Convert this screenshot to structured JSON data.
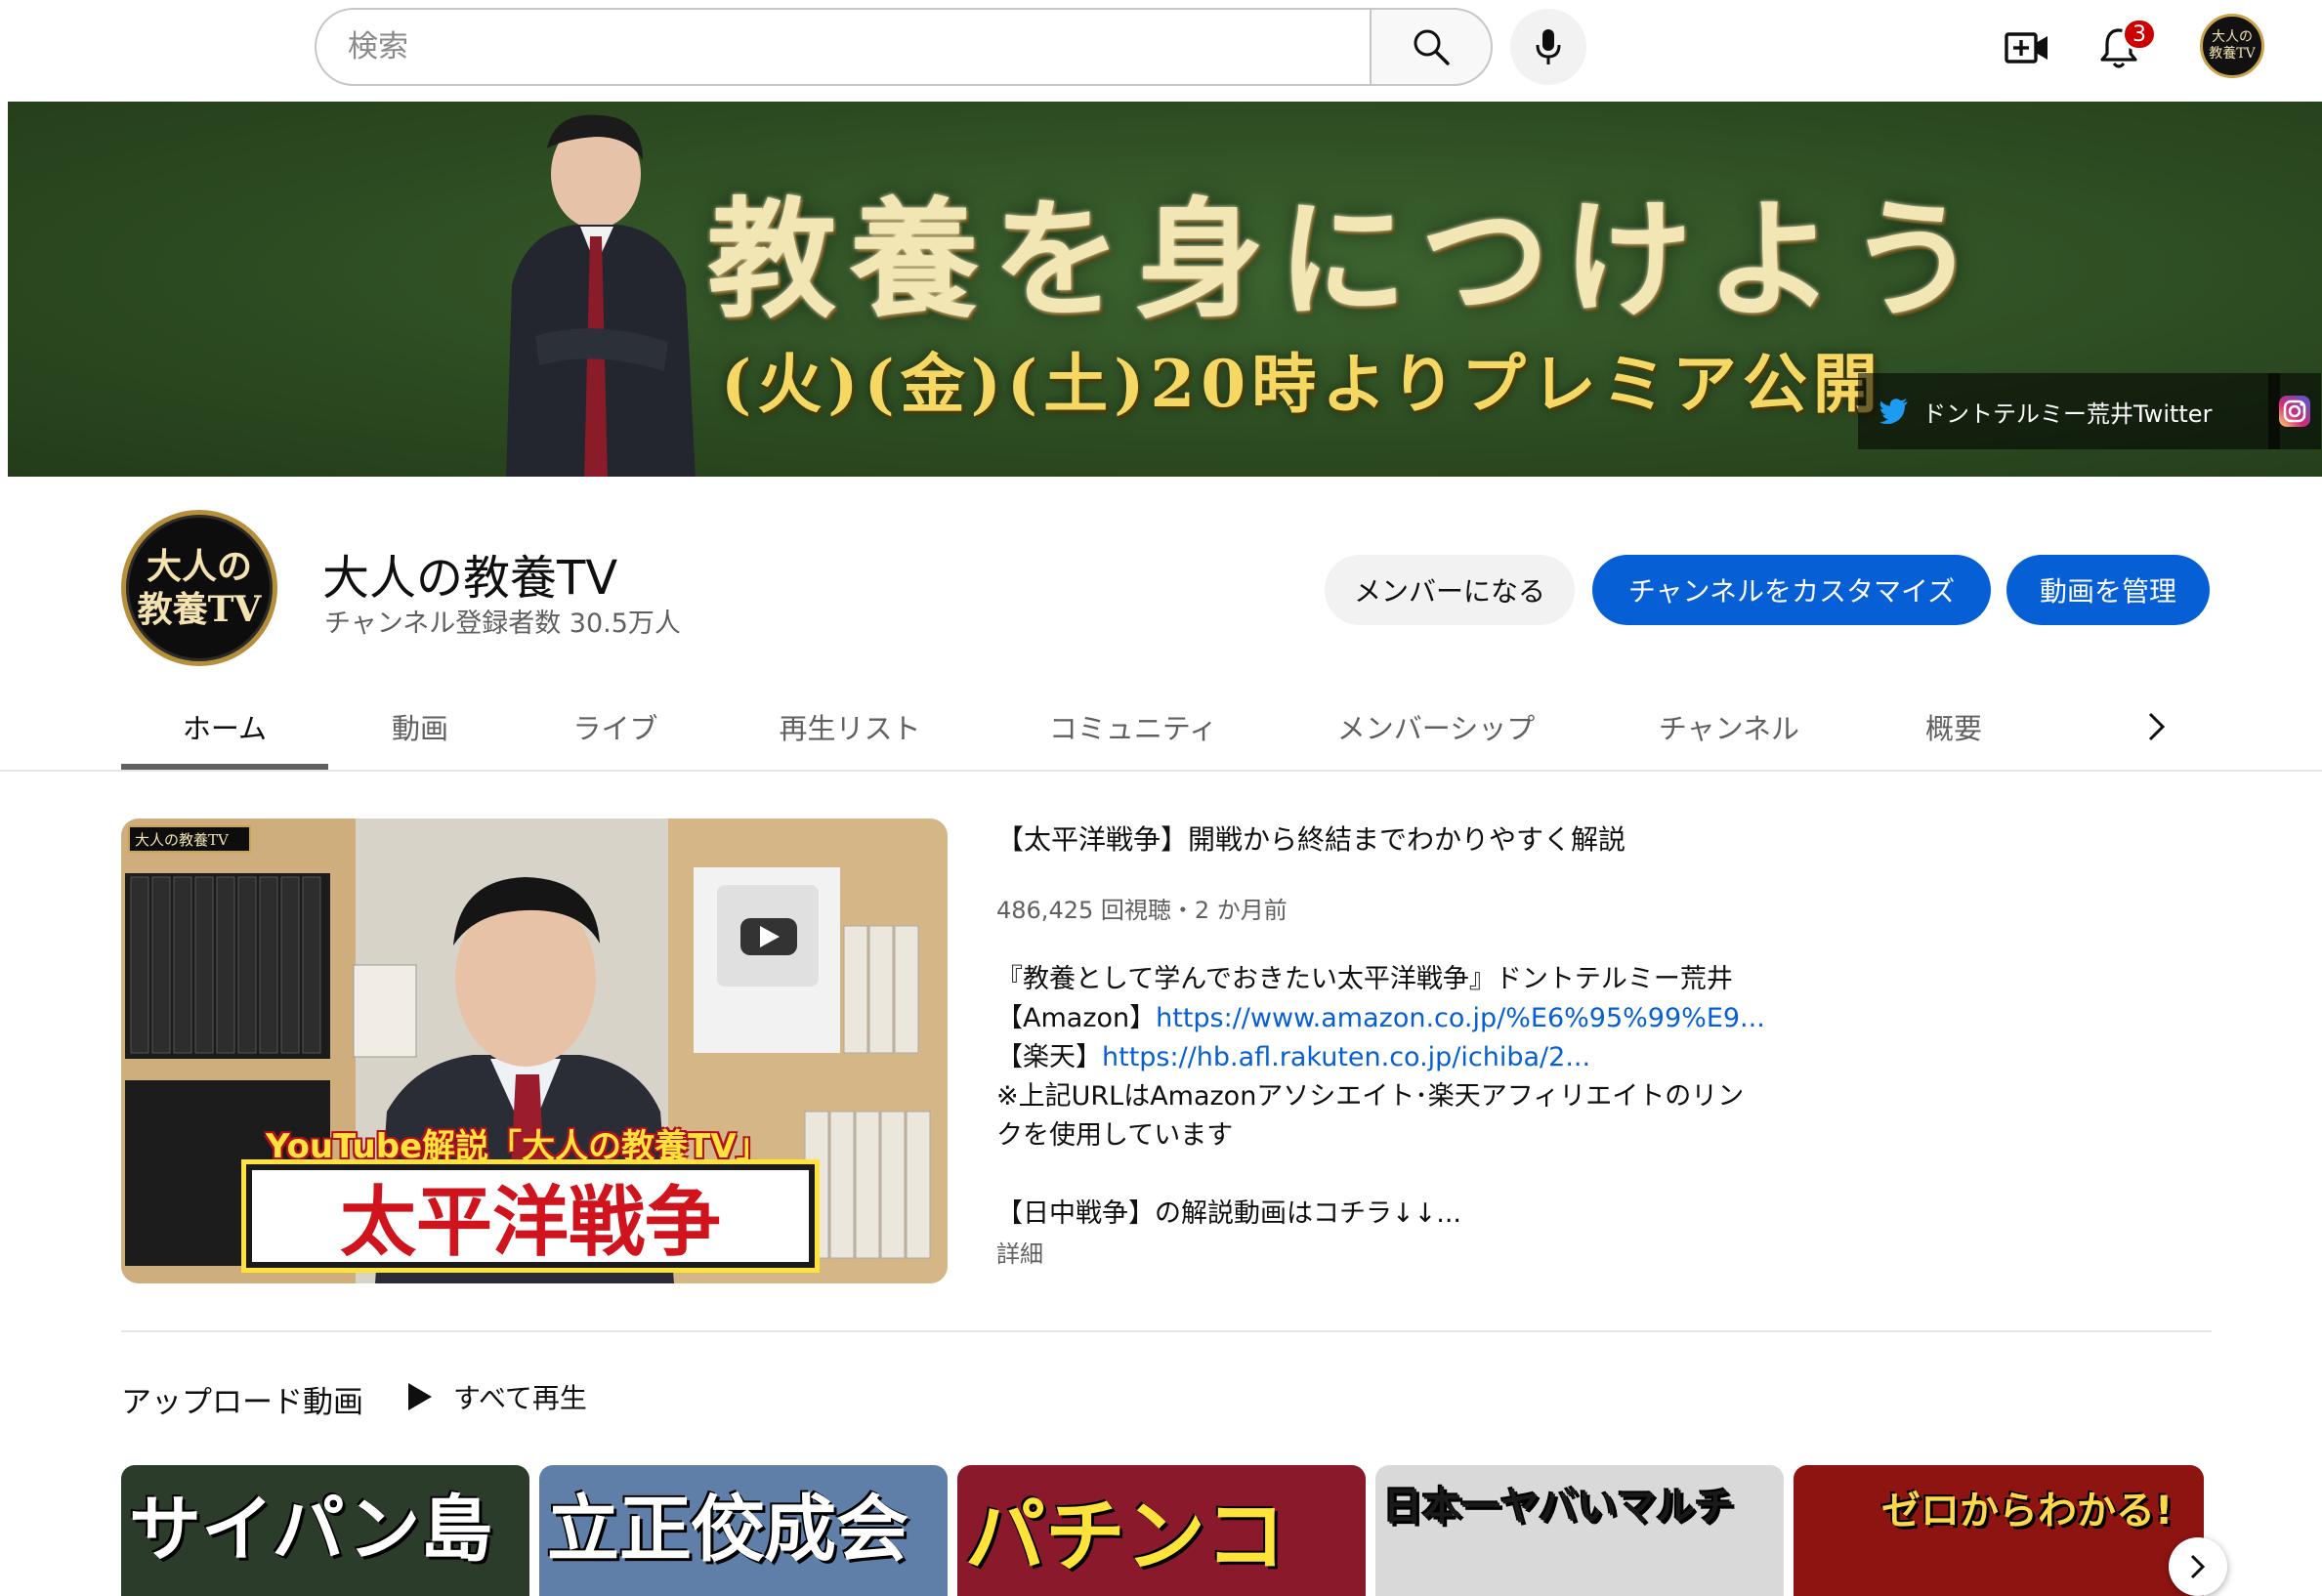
{
  "search": {
    "placeholder": "検索"
  },
  "notifications": {
    "count": "3"
  },
  "account": {
    "avatar_text_line1": "大人の",
    "avatar_text_line2": "教養TV"
  },
  "banner": {
    "title": "教養を身につけよう",
    "subtitle": "(火)(金)(土)20時よりプレミア公開",
    "link_label": "ドントテルミー荒井Twitter"
  },
  "channel": {
    "avatar_line1": "大人の",
    "avatar_line2": "教養TV",
    "name": "大人の教養TV",
    "subscribers": "チャンネル登録者数 30.5万人",
    "buttons": {
      "member": "メンバーになる",
      "customize": "チャンネルをカスタマイズ",
      "manage": "動画を管理"
    }
  },
  "tabs": [
    {
      "label": "ホーム"
    },
    {
      "label": "動画"
    },
    {
      "label": "ライブ"
    },
    {
      "label": "再生リスト"
    },
    {
      "label": "コミュニティ"
    },
    {
      "label": "メンバーシップ"
    },
    {
      "label": "チャンネル"
    },
    {
      "label": "概要"
    }
  ],
  "featured": {
    "thumb_corner_label": "大人の教養TV",
    "thumb_caption_top": "YouTube解説「大人の教養TV」",
    "thumb_caption_main": "太平洋戦争",
    "title": "【太平洋戦争】開戦から終結までわかりやすく解説",
    "meta": "486,425 回視聴・2 か月前",
    "desc_line1": "『教養として学んでおきたい太平洋戦争』ドントテルミー荒井",
    "desc_line2_label": "【Amazon】",
    "desc_line2_link": "https://www.amazon.co.jp/%E6%95%99%E9...",
    "desc_line3_label": "【楽天】",
    "desc_line3_link": "https://hb.afl.rakuten.co.jp/ichiba/2...",
    "desc_line4": "※上記URLはAmazonアソシエイト･楽天アフィリエイトのリン",
    "desc_line5": "クを使用しています",
    "desc_line6": "【日中戦争】の解説動画はコチラ↓↓...",
    "more": "詳細"
  },
  "uploads": {
    "title": "アップロード動画",
    "play_all": "すべて再生",
    "thumbnails": [
      {
        "text": "サイパン島",
        "bg": "#2b3d2a",
        "fg": "#ffffff"
      },
      {
        "text": "立正佼成会",
        "bg": "#5f7fa8",
        "fg": "#ffffff"
      },
      {
        "text": "パチンコ",
        "bg": "#8a1a2b",
        "fg": "#ffe23a"
      },
      {
        "text": "日本一ヤバいマルチ",
        "bg": "#d9d9d9",
        "fg": "#1a1a1a"
      },
      {
        "text": "ゼロからわかる!",
        "bg": "#8e1412",
        "fg": "#ffd84a"
      }
    ]
  }
}
